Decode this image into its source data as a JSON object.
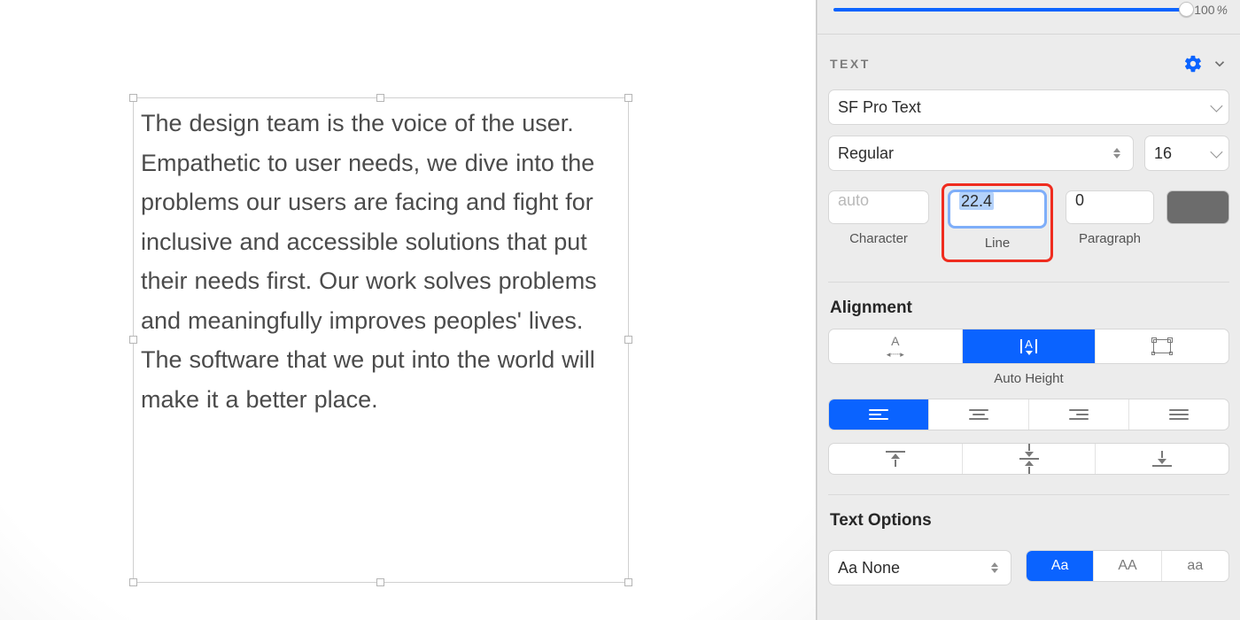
{
  "canvas": {
    "text": "The design team is the voice of the user. Empathetic to user needs, we dive into the problems our users are facing and fight for inclusive and accessible solutions that put their needs first. Our work solves problems and meaningfully improves peoples' lives. The software that we put into the world will make it a better place."
  },
  "zoom": {
    "value": "100",
    "suffix": "%"
  },
  "text_panel": {
    "title": "TEXT",
    "font_family": "SF Pro Text",
    "font_weight": "Regular",
    "font_size": "16",
    "spacing": {
      "character": {
        "value": "",
        "placeholder": "auto",
        "label": "Character"
      },
      "line": {
        "value": "22.4",
        "label": "Line"
      },
      "paragraph": {
        "value": "0",
        "label": "Paragraph"
      }
    },
    "color": "#6c6c6c"
  },
  "alignment": {
    "title": "Alignment",
    "resize_caption": "Auto Height",
    "resize_active_index": 1,
    "h_align_active_index": 0
  },
  "text_options": {
    "title": "Text Options",
    "transform": "Aa None",
    "case_labels": [
      "Aa",
      "AA",
      "aa"
    ],
    "case_active_index": 0
  }
}
